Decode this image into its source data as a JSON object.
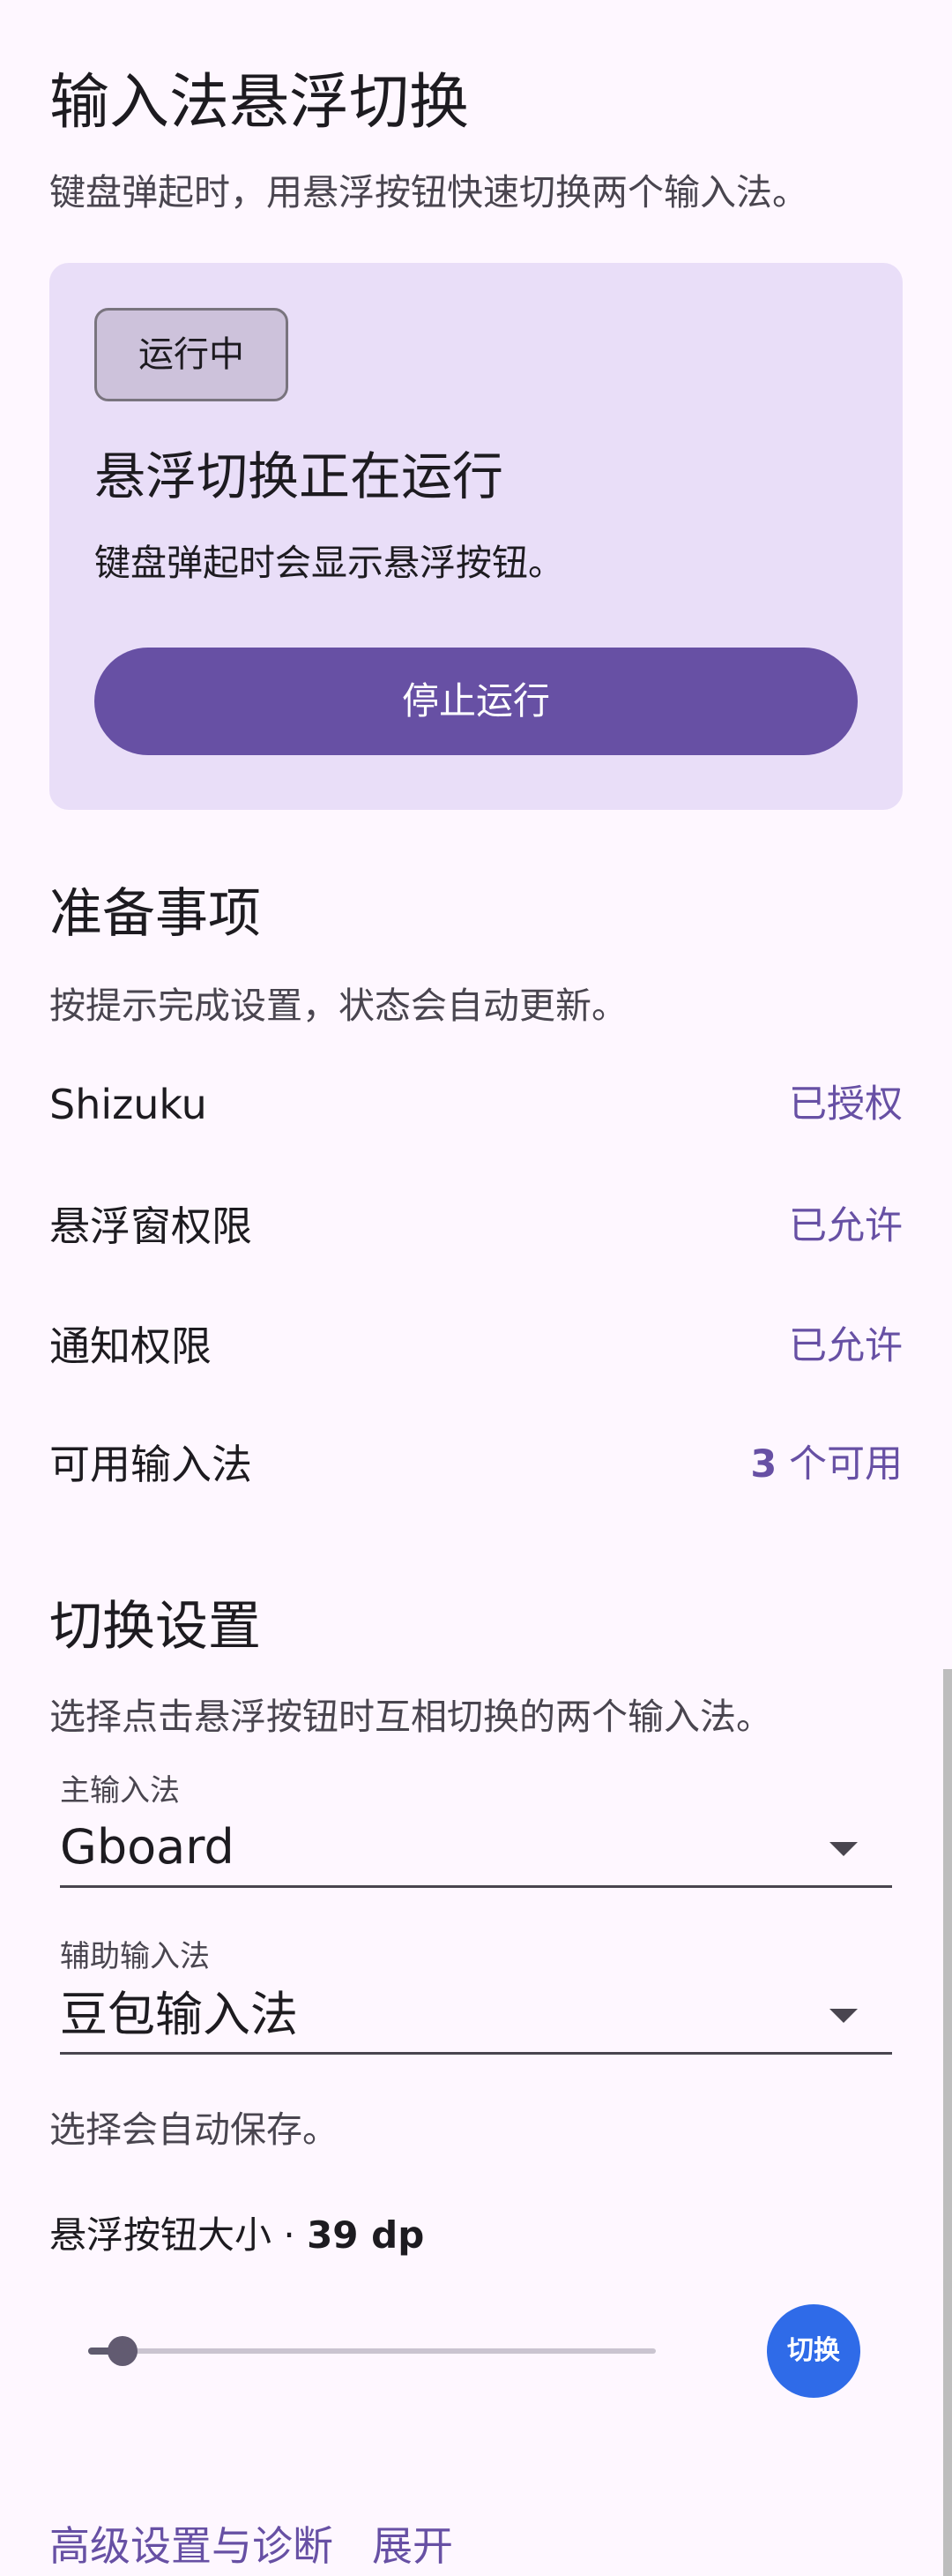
{
  "header": {
    "title": "输入法悬浮切换",
    "subtitle": "键盘弹起时，用悬浮按钮快速切换两个输入法。"
  },
  "status_card": {
    "chip": "运行中",
    "title": "悬浮切换正在运行",
    "subtitle": "键盘弹起时会显示悬浮按钮。",
    "stop_button": "停止运行"
  },
  "prep": {
    "title": "准备事项",
    "subtitle": "按提示完成设置，状态会自动更新。",
    "items": [
      {
        "label": "Shizuku",
        "value": "已授权"
      },
      {
        "label": "悬浮窗权限",
        "value": "已允许"
      },
      {
        "label": "通知权限",
        "value": "已允许"
      },
      {
        "label": "可用输入法",
        "value_num": "3",
        "value_text": " 个可用"
      }
    ]
  },
  "switch_settings": {
    "title": "切换设置",
    "subtitle": "选择点击悬浮按钮时互相切换的两个输入法。",
    "primary": {
      "label": "主输入法",
      "value": "Gboard"
    },
    "secondary": {
      "label": "辅助输入法",
      "value": "豆包输入法"
    },
    "autosave_note": "选择会自动保存。",
    "size_label": "悬浮按钮大小 · ",
    "size_value": "39 dp",
    "slider_fraction": 0.06,
    "preview_button": "切换"
  },
  "advanced": {
    "label": "高级设置与诊断",
    "toggle": "展开"
  },
  "colors": {
    "primary": "#6750A4",
    "card_bg": "#E9DEF8",
    "background": "#FEF7FF",
    "fab": "#2F6BE8"
  }
}
